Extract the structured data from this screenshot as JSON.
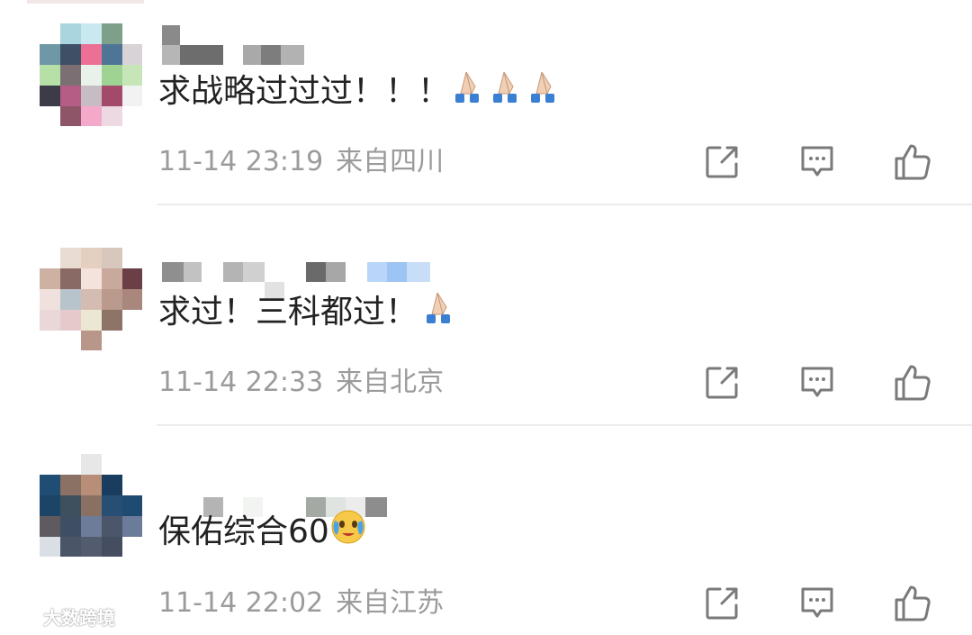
{
  "comments": [
    {
      "text": "求战略过过过！！！",
      "emoji": "folded-hands-icon x3",
      "time": "11-14 23:19",
      "location": "来自四川"
    },
    {
      "text": "求过！三科都过！",
      "emoji": "folded-hands-icon",
      "time": "11-14 22:33",
      "location": "来自北京"
    },
    {
      "text": "保佑综合60",
      "emoji": "crying-smile-icon",
      "time": "11-14 22:02",
      "location": "来自江苏"
    }
  ],
  "watermark": {
    "text": "大数跨境"
  },
  "colors": {
    "text": "#222222",
    "meta": "#9b9b9b",
    "icon": "#7a7a7a",
    "divider": "#ececec"
  }
}
